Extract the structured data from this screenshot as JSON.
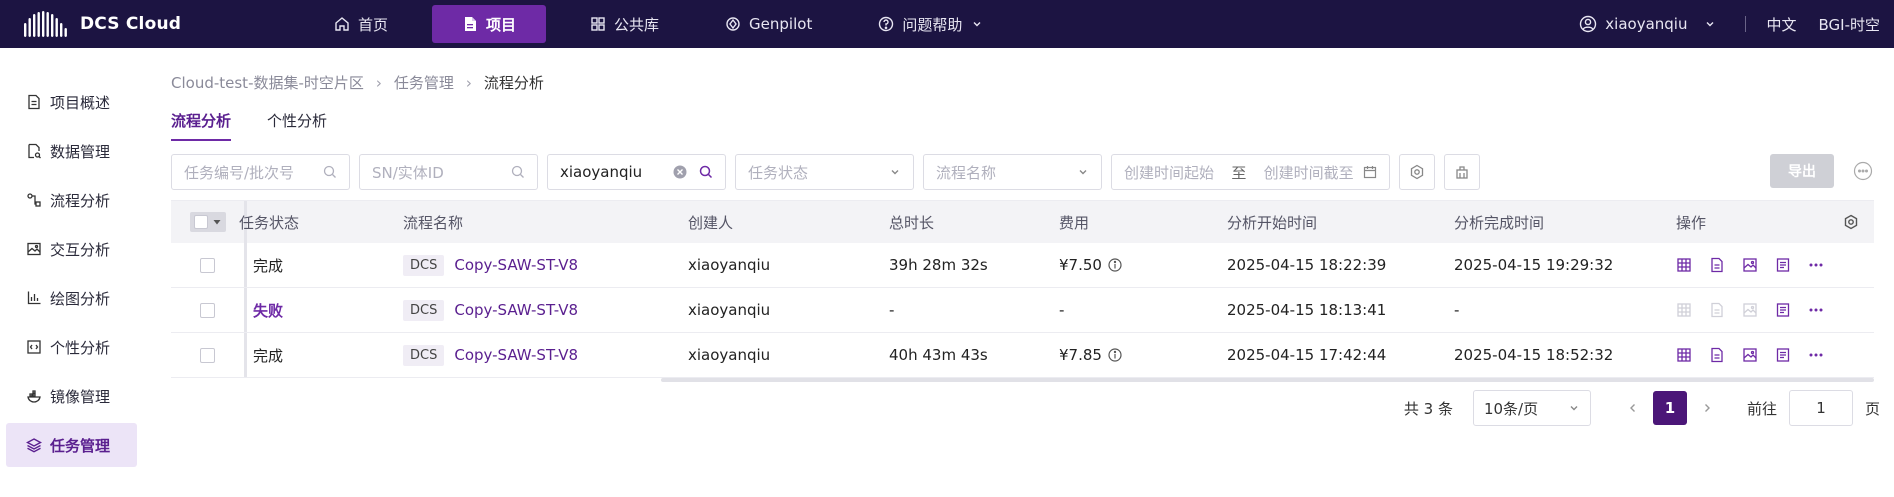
{
  "app": {
    "name": "DCS Cloud"
  },
  "nav": {
    "items": [
      {
        "label": "首页",
        "icon": "home-icon",
        "active": false
      },
      {
        "label": "项目",
        "icon": "document-icon",
        "active": true
      },
      {
        "label": "公共库",
        "icon": "grid-icon",
        "active": false
      },
      {
        "label": "Genpilot",
        "icon": "genpilot-icon",
        "active": false
      },
      {
        "label": "问题帮助",
        "icon": "help-icon",
        "active": false
      }
    ]
  },
  "header": {
    "username": "xiaoyanqiu",
    "language": "中文",
    "org": "BGI-时空"
  },
  "sidebar": {
    "items": [
      {
        "label": "项目概述",
        "icon": "file-icon"
      },
      {
        "label": "数据管理",
        "icon": "data-icon"
      },
      {
        "label": "流程分析",
        "icon": "flow-icon"
      },
      {
        "label": "交互分析",
        "icon": "image-icon"
      },
      {
        "label": "绘图分析",
        "icon": "chart-icon"
      },
      {
        "label": "个性分析",
        "icon": "code-icon"
      },
      {
        "label": "镜像管理",
        "icon": "container-icon"
      },
      {
        "label": "任务管理",
        "icon": "layers-icon",
        "active": true
      }
    ]
  },
  "breadcrumb": [
    "Cloud-test-数据集-时空片区",
    "任务管理",
    "流程分析"
  ],
  "tabs": [
    {
      "label": "流程分析",
      "active": true
    },
    {
      "label": "个性分析",
      "active": false
    }
  ],
  "filters": {
    "task_id_placeholder": "任务编号/批次号",
    "sn_placeholder": "SN/实体ID",
    "creator_value": "xiaoyanqiu",
    "status_placeholder": "任务状态",
    "flow_name_placeholder": "流程名称",
    "created_start_placeholder": "创建时间起始",
    "range_sep": "至",
    "created_end_placeholder": "创建时间截至"
  },
  "export_label": "导出",
  "table": {
    "headers": {
      "status": "任务状态",
      "flow_name": "流程名称",
      "creator": "创建人",
      "duration": "总时长",
      "cost": "费用",
      "start_time": "分析开始时间",
      "end_time": "分析完成时间",
      "ops": "操作"
    },
    "rows": [
      {
        "status": "完成",
        "tag": "DCS",
        "flow_name": "Copy-SAW-ST-V8",
        "creator": "xiaoyanqiu",
        "duration": "39h 28m 32s",
        "cost": "¥7.50",
        "start_time": "2025-04-15 18:22:39",
        "end_time": "2025-04-15 19:29:32"
      },
      {
        "status": "失败",
        "tag": "DCS",
        "flow_name": "Copy-SAW-ST-V8",
        "creator": "xiaoyanqiu",
        "duration": "-",
        "cost": "-",
        "start_time": "2025-04-15 18:13:41",
        "end_time": "-"
      },
      {
        "status": "完成",
        "tag": "DCS",
        "flow_name": "Copy-SAW-ST-V8",
        "creator": "xiaoyanqiu",
        "duration": "40h 43m 43s",
        "cost": "¥7.85",
        "start_time": "2025-04-15 17:42:44",
        "end_time": "2025-04-15 18:52:32"
      }
    ]
  },
  "pagination": {
    "total": "共 3 条",
    "page_size": "10条/页",
    "current": "1",
    "goto_label": "前往",
    "goto_value": "1",
    "page_unit": "页"
  },
  "colors": {
    "topbar": "#1c1442",
    "accent": "#6e2aa6",
    "accent_dark": "#4b1678"
  }
}
